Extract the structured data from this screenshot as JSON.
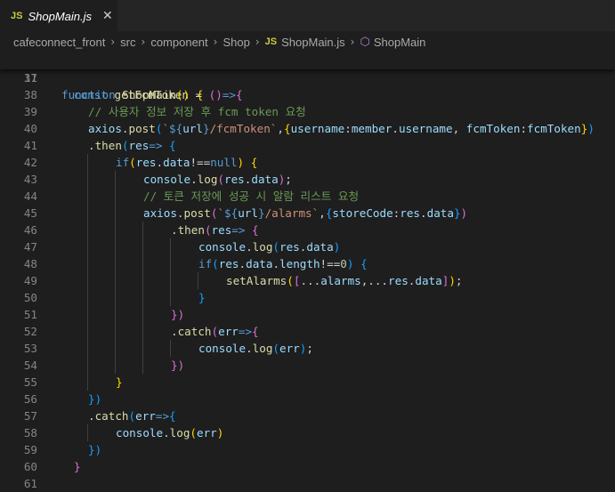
{
  "tab": {
    "icon": "JS",
    "name": "ShopMain.js",
    "close": "✕"
  },
  "breadcrumb": {
    "segments": [
      "cafeconnect_front",
      "src",
      "component",
      "Shop"
    ],
    "file_icon": "JS",
    "file": "ShopMain.js",
    "symbol": "ShopMain"
  },
  "sticky": {
    "line_no": "11"
  },
  "code": {
    "line_numbers": [
      "37",
      "38",
      "39",
      "40",
      "41",
      "42",
      "43",
      "44",
      "45",
      "46",
      "47",
      "48",
      "49",
      "50",
      "51",
      "52",
      "53",
      "54",
      "55",
      "56",
      "57",
      "58",
      "59",
      "60",
      "61"
    ],
    "lines": [
      [],
      [
        [
          "k",
          "const "
        ],
        [
          "f",
          "getFcmToken"
        ],
        [
          "t",
          " = "
        ],
        [
          "b2",
          "()"
        ],
        [
          "k",
          "=>"
        ],
        [
          "b2",
          "{"
        ]
      ],
      [
        [
          "c",
          "// 사용자 정보 저장 후 fcm token 요청"
        ]
      ],
      [
        [
          "v",
          "axios"
        ],
        [
          "t",
          "."
        ],
        [
          "f",
          "post"
        ],
        [
          "b3",
          "("
        ],
        [
          "s",
          "`"
        ],
        [
          "k",
          "${"
        ],
        [
          "v",
          "url"
        ],
        [
          "k",
          "}"
        ],
        [
          "s",
          "/fcmToken`"
        ],
        [
          "t",
          ","
        ],
        [
          "b1",
          "{"
        ],
        [
          "v",
          "username"
        ],
        [
          "t",
          ":"
        ],
        [
          "v",
          "member"
        ],
        [
          "t",
          "."
        ],
        [
          "v",
          "username"
        ],
        [
          "t",
          ", "
        ],
        [
          "v",
          "fcmToken"
        ],
        [
          "t",
          ":"
        ],
        [
          "v",
          "fcmToken"
        ],
        [
          "b1",
          "}"
        ],
        [
          "b3",
          ")"
        ]
      ],
      [
        [
          "t",
          "."
        ],
        [
          "f",
          "then"
        ],
        [
          "b3",
          "("
        ],
        [
          "v",
          "res"
        ],
        [
          "k",
          "=>"
        ],
        [
          "t",
          " "
        ],
        [
          "b3",
          "{"
        ]
      ],
      [
        [
          "k",
          "if"
        ],
        [
          "b1",
          "("
        ],
        [
          "v",
          "res"
        ],
        [
          "t",
          "."
        ],
        [
          "v",
          "data"
        ],
        [
          "t",
          "!=="
        ],
        [
          "k",
          "null"
        ],
        [
          "b1",
          ")"
        ],
        [
          "t",
          " "
        ],
        [
          "b1",
          "{"
        ]
      ],
      [
        [
          "v",
          "console"
        ],
        [
          "t",
          "."
        ],
        [
          "f",
          "log"
        ],
        [
          "b2",
          "("
        ],
        [
          "v",
          "res"
        ],
        [
          "t",
          "."
        ],
        [
          "v",
          "data"
        ],
        [
          "b2",
          ")"
        ],
        [
          "t",
          ";"
        ]
      ],
      [
        [
          "c",
          "// 토큰 저장에 성공 시 알람 리스트 요청"
        ]
      ],
      [
        [
          "v",
          "axios"
        ],
        [
          "t",
          "."
        ],
        [
          "f",
          "post"
        ],
        [
          "b2",
          "("
        ],
        [
          "s",
          "`"
        ],
        [
          "k",
          "${"
        ],
        [
          "v",
          "url"
        ],
        [
          "k",
          "}"
        ],
        [
          "s",
          "/alarms`"
        ],
        [
          "t",
          ","
        ],
        [
          "b3",
          "{"
        ],
        [
          "v",
          "storeCode"
        ],
        [
          "t",
          ":"
        ],
        [
          "v",
          "res"
        ],
        [
          "t",
          "."
        ],
        [
          "v",
          "data"
        ],
        [
          "b3",
          "}"
        ],
        [
          "b2",
          ")"
        ]
      ],
      [
        [
          "t",
          "."
        ],
        [
          "f",
          "then"
        ],
        [
          "b2",
          "("
        ],
        [
          "v",
          "res"
        ],
        [
          "k",
          "=>"
        ],
        [
          "t",
          " "
        ],
        [
          "b2",
          "{"
        ]
      ],
      [
        [
          "v",
          "console"
        ],
        [
          "t",
          "."
        ],
        [
          "f",
          "log"
        ],
        [
          "b3",
          "("
        ],
        [
          "v",
          "res"
        ],
        [
          "t",
          "."
        ],
        [
          "v",
          "data"
        ],
        [
          "b3",
          ")"
        ]
      ],
      [
        [
          "k",
          "if"
        ],
        [
          "b3",
          "("
        ],
        [
          "v",
          "res"
        ],
        [
          "t",
          "."
        ],
        [
          "v",
          "data"
        ],
        [
          "t",
          "."
        ],
        [
          "v",
          "length"
        ],
        [
          "t",
          "!=="
        ],
        [
          "n",
          "0"
        ],
        [
          "b3",
          ")"
        ],
        [
          "t",
          " "
        ],
        [
          "b3",
          "{"
        ]
      ],
      [
        [
          "f",
          "setAlarms"
        ],
        [
          "b1",
          "("
        ],
        [
          "b2",
          "["
        ],
        [
          "t",
          "..."
        ],
        [
          "v",
          "alarms"
        ],
        [
          "t",
          ",..."
        ],
        [
          "v",
          "res"
        ],
        [
          "t",
          "."
        ],
        [
          "v",
          "data"
        ],
        [
          "b2",
          "]"
        ],
        [
          "b1",
          ")"
        ],
        [
          "t",
          ";"
        ]
      ],
      [
        [
          "b3",
          "}"
        ]
      ],
      [
        [
          "b2",
          "})"
        ]
      ],
      [
        [
          "t",
          "."
        ],
        [
          "f",
          "catch"
        ],
        [
          "b2",
          "("
        ],
        [
          "v",
          "err"
        ],
        [
          "k",
          "=>"
        ],
        [
          "b2",
          "{"
        ]
      ],
      [
        [
          "v",
          "console"
        ],
        [
          "t",
          "."
        ],
        [
          "f",
          "log"
        ],
        [
          "b3",
          "("
        ],
        [
          "v",
          "err"
        ],
        [
          "b3",
          ")"
        ],
        [
          "t",
          ";"
        ]
      ],
      [
        [
          "b2",
          "})"
        ]
      ],
      [
        [
          "b1",
          "}"
        ]
      ],
      [
        [
          "b3",
          "})"
        ]
      ],
      [
        [
          "t",
          "."
        ],
        [
          "f",
          "catch"
        ],
        [
          "b3",
          "("
        ],
        [
          "v",
          "err"
        ],
        [
          "k",
          "=>"
        ],
        [
          "b3",
          "{"
        ]
      ],
      [
        [
          "v",
          "console"
        ],
        [
          "t",
          "."
        ],
        [
          "f",
          "log"
        ],
        [
          "b1",
          "("
        ],
        [
          "v",
          "err"
        ],
        [
          "b1",
          ")"
        ]
      ],
      [
        [
          "b3",
          "})"
        ]
      ],
      [
        [
          "b2",
          "}"
        ]
      ],
      []
    ]
  },
  "sticky_code": [
    [
      "k",
      "function "
    ],
    [
      "f",
      "ShopMain"
    ],
    [
      "b1",
      "()"
    ],
    [
      "t",
      " "
    ],
    [
      "b1",
      "{"
    ]
  ]
}
